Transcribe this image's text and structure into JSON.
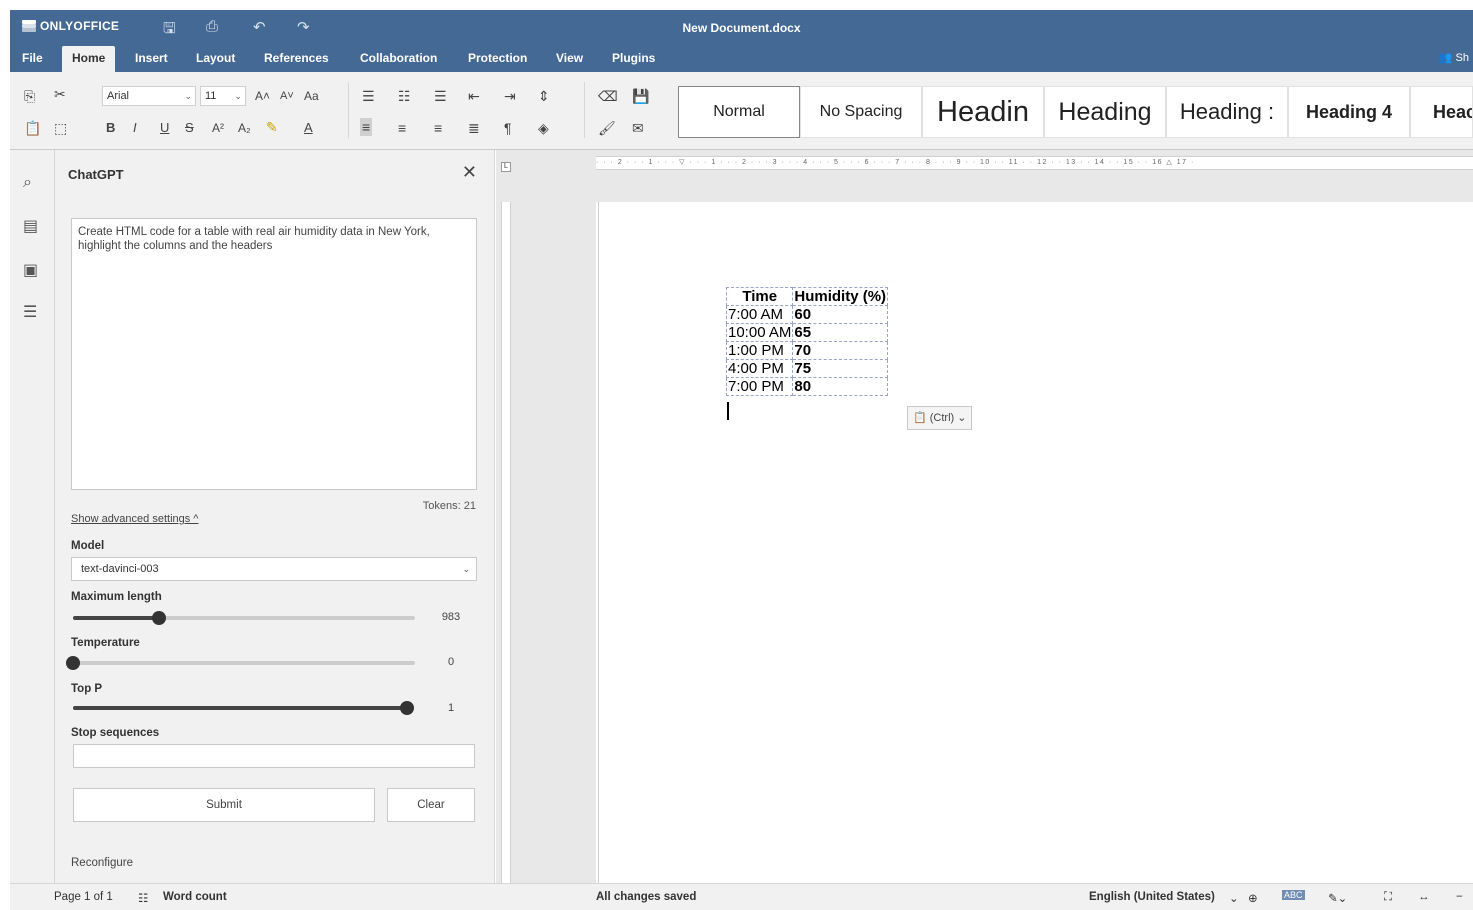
{
  "app": {
    "logo_text": "ONLYOFFICE",
    "document_title": "New Document.docx"
  },
  "tabs": [
    "File",
    "Home",
    "Insert",
    "Layout",
    "References",
    "Collaboration",
    "Protection",
    "View",
    "Plugins"
  ],
  "share_label": "Sh",
  "toolbar": {
    "font_name": "Arial",
    "font_size": "11",
    "styles": [
      "Normal",
      "No Spacing",
      "Headin",
      "Heading",
      "Heading :",
      "Heading 4",
      "Heac"
    ]
  },
  "panel": {
    "title": "ChatGPT",
    "prompt_text": "Create HTML code for a table with real air humidity data in New York, highlight the columns and the headers",
    "tokens": "Tokens: 21",
    "advanced_settings": "Show advanced settings ^",
    "model_label": "Model",
    "model_value": "text-davinci-003",
    "max_length_label": "Maximum length",
    "max_length_value": "983",
    "max_length_fraction": 0.25,
    "temperature_label": "Temperature",
    "temperature_value": "0",
    "temperature_fraction": 0.0,
    "top_p_label": "Top P",
    "top_p_value": "1",
    "top_p_fraction": 1.0,
    "stop_sequences_label": "Stop sequences",
    "stop_sequences_value": "",
    "submit_label": "Submit",
    "clear_label": "Clear",
    "reconfigure_label": "Reconfigure"
  },
  "document": {
    "table": {
      "headers": [
        "Time",
        "Humidity (%)"
      ],
      "rows": [
        [
          "7:00 AM",
          "60"
        ],
        [
          "10:00 AM",
          "65"
        ],
        [
          "1:00 PM",
          "70"
        ],
        [
          "4:00 PM",
          "75"
        ],
        [
          "7:00 PM",
          "80"
        ]
      ]
    },
    "paste_label": "(Ctrl)"
  },
  "status": {
    "page": "Page 1 of 1",
    "word_count": "Word count",
    "save_state": "All changes saved",
    "language": "English (United States)"
  },
  "colors": {
    "header_blue": "#446995",
    "toolbar_gray": "#f1f1f1"
  }
}
